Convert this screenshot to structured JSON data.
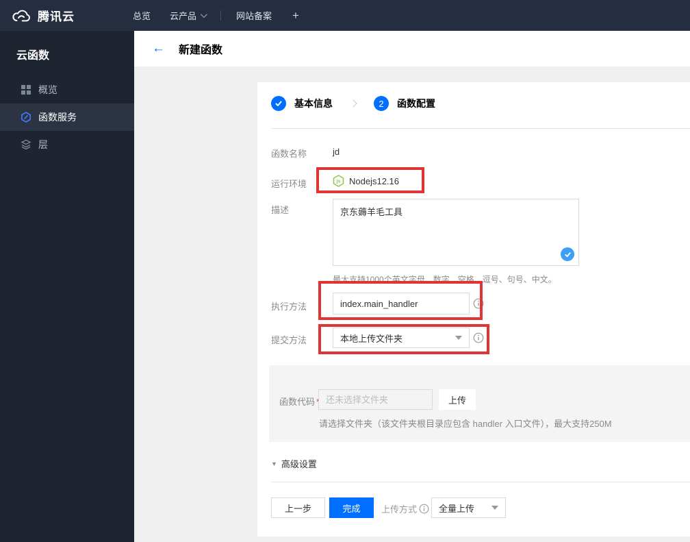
{
  "topbar": {
    "brand": "腾讯云",
    "items": [
      {
        "label": "总览"
      },
      {
        "label": "云产品"
      },
      {
        "label": "网站备案"
      }
    ],
    "plus": "+"
  },
  "sidebar": {
    "title": "云函数",
    "items": [
      {
        "label": "概览"
      },
      {
        "label": "函数服务"
      },
      {
        "label": "层"
      }
    ]
  },
  "header": {
    "back_glyph": "←",
    "title": "新建函数"
  },
  "steps": [
    {
      "label": "基本信息"
    },
    {
      "number": "2",
      "label": "函数配置"
    }
  ],
  "form": {
    "name_label": "函数名称",
    "name_value": "jd",
    "runtime_label": "运行环境",
    "runtime_value": "Nodejs12.16",
    "desc_label": "描述",
    "desc_value": "京东薅羊毛工具",
    "desc_hint": "最大支持1000个英文字母、数字、空格、逗号、句号、中文。",
    "handler_label": "执行方法",
    "handler_value": "index.main_handler",
    "submit_label": "提交方法",
    "submit_value": "本地上传文件夹",
    "code_label": "函数代码",
    "code_required": "*",
    "code_placeholder": "还未选择文件夹",
    "upload_button": "上传",
    "code_hint": "请选择文件夹（该文件夹根目录应包含 handler 入口文件），最大支持250M",
    "advanced_label": "高级设置",
    "advanced_caret": "▼"
  },
  "footer": {
    "prev": "上一步",
    "finish": "完成",
    "upload_mode_label": "上传方式",
    "upload_mode_value": "全量上传"
  },
  "colors": {
    "accent": "#006eff",
    "annotation_red": "#e13434",
    "node_green": "#8cc84b",
    "topbar_bg": "#252e40",
    "sidebar_bg": "#1e2430"
  }
}
